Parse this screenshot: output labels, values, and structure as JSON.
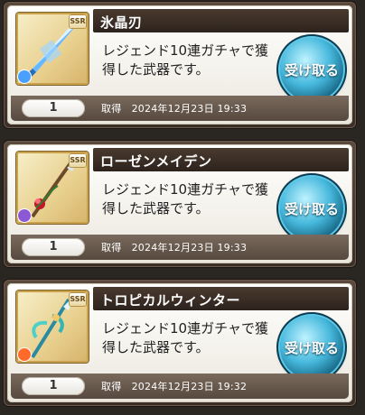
{
  "items": [
    {
      "title": "氷晶刃",
      "rarity": "SSR",
      "element_color": "#4aa0ff",
      "description_line1": "レジェンド10連ガチャで獲",
      "description_line2": "得した武器です。",
      "claim_label": "受け取る",
      "quantity": "1",
      "acquired_text": "取得　2024年12月23日 19:33",
      "icon": "ice-sword-icon"
    },
    {
      "title": "ローゼンメイデン",
      "rarity": "SSR",
      "element_color": "#8d58d6",
      "description_line1": "レジェンド10連ガチャで獲",
      "description_line2": "得した武器です。",
      "claim_label": "受け取る",
      "quantity": "1",
      "acquired_text": "取得　2024年12月23日 19:33",
      "icon": "rose-spear-icon"
    },
    {
      "title": "トロピカルウィンター",
      "rarity": "SSR",
      "element_color": "#ff6a2a",
      "description_line1": "レジェンド10連ガチャで獲",
      "description_line2": "得した武器です。",
      "claim_label": "受け取る",
      "quantity": "1",
      "acquired_text": "取得　2024年12月23日 19:32",
      "icon": "tropical-spear-icon"
    }
  ]
}
